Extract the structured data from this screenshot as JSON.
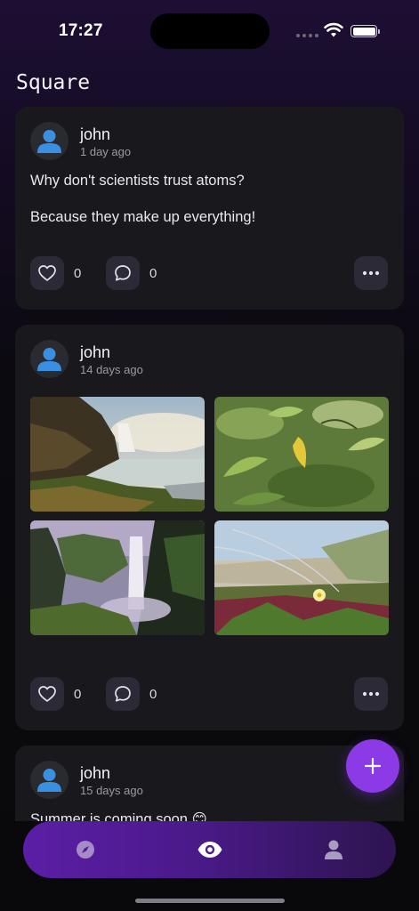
{
  "status_bar": {
    "time": "17:27"
  },
  "page": {
    "title": "Square"
  },
  "posts": [
    {
      "author": "john",
      "time_ago": "1 day ago",
      "lines": [
        "Why don't scientists trust atoms?",
        "Because they make up everything!"
      ],
      "likes": "0",
      "comments": "0"
    },
    {
      "author": "john",
      "time_ago": "14 days ago",
      "images": [
        "waterfall-landscape-photo",
        "green-leaves-photo",
        "misty-waterfall-photo",
        "flowers-beach-photo"
      ],
      "likes": "0",
      "comments": "0"
    },
    {
      "author": "john",
      "time_ago": "15 days ago",
      "lines": [
        "Summer is coming soon 😊"
      ]
    }
  ],
  "fab": {
    "icon": "plus-icon"
  },
  "tabbar": {
    "tabs": [
      "compass-icon",
      "eye-icon",
      "person-icon"
    ],
    "active": "eye-icon"
  },
  "colors": {
    "accent": "#8b3ae6",
    "card": "#19181d",
    "avatar_icon": "#3a8fe0"
  }
}
